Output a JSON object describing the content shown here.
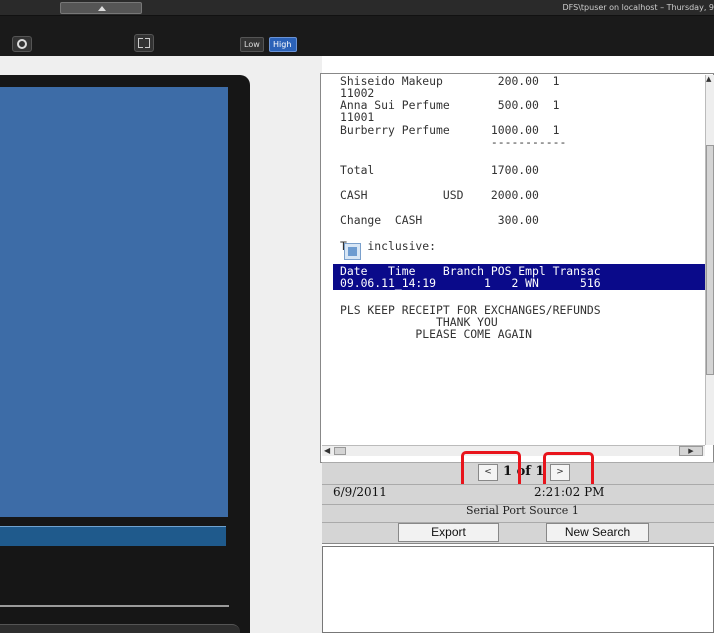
{
  "header": {
    "session": "DFS\\tpuser on localhost  –  Thursday, 9"
  },
  "toolbar": {
    "icons": [
      "camera-icon",
      "expand-icon"
    ],
    "quality_low": "Low",
    "quality_high": "High"
  },
  "receipt": {
    "lines": [
      "Shiseido Makeup        200.00  1",
      "11002",
      "Anna Sui Perfume       500.00  1",
      "11001",
      "Burberry Perfume      1000.00  1",
      "                      -----------"
    ],
    "total": "Total                 1700.00",
    "cash": "CASH           USD    2000.00",
    "change": "Change  CASH           300.00",
    "tax": "Tax inclusive:",
    "tax_icon": "broken-image-icon",
    "header_row": "Date   Time    Branch POS Empl Transac",
    "data_row": "09.06.11_14:19       1   2 WN      516",
    "footer": [
      "PLS KEEP RECEIPT FOR EXCHANGES/REFUNDS",
      "              THANK YOU",
      "           PLEASE COME AGAIN"
    ]
  },
  "navigation": {
    "prev": "<",
    "next": ">",
    "page": "1 of 1"
  },
  "info": {
    "date": "6/9/2011",
    "time": "2:21:02 PM",
    "source": "Serial Port Source 1"
  },
  "actions": {
    "export": "Export",
    "new_search": "New Search"
  },
  "colors": {
    "video_blue": "#3d6ca7",
    "highlight_navy": "#0a0a8a",
    "annotation_red": "#e8141c",
    "quality_high_blue": "#2b62b8"
  }
}
